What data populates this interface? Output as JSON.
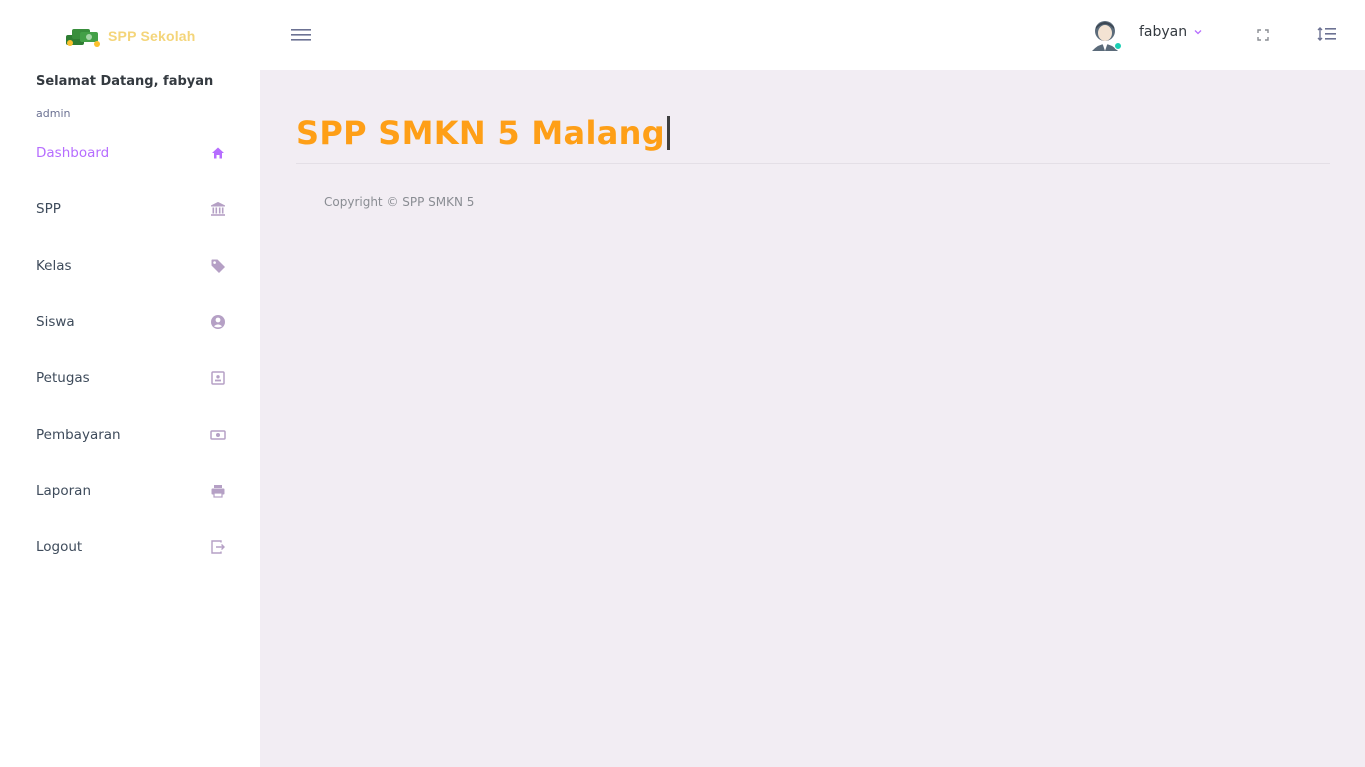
{
  "navbar": {
    "brand_text": "SPP Sekolah",
    "brand_icon": "money-stack-icon",
    "menu_icon": "hamburger-menu-icon",
    "profile_name": "fabyan",
    "status_color": "#1bcfb4",
    "fullscreen_icon": "fullscreen-icon",
    "settings_icon": "list-settings-icon"
  },
  "sidebar": {
    "welcome": "Selamat Datang, fabyan",
    "role": "admin",
    "accent_color": "#b66dff",
    "items": [
      {
        "label": "Dashboard",
        "icon": "home-icon",
        "active": true
      },
      {
        "label": "SPP",
        "icon": "bank-icon",
        "active": false
      },
      {
        "label": "Kelas",
        "icon": "tag-icon",
        "active": false
      },
      {
        "label": "Siswa",
        "icon": "user-circle-icon",
        "active": false
      },
      {
        "label": "Petugas",
        "icon": "contact-card-icon",
        "active": false
      },
      {
        "label": "Pembayaran",
        "icon": "cash-icon",
        "active": false
      },
      {
        "label": "Laporan",
        "icon": "printer-icon",
        "active": false
      },
      {
        "label": "Logout",
        "icon": "logout-icon",
        "active": false
      }
    ]
  },
  "main": {
    "title": "SPP SMKN 5 Malang",
    "title_color": "#fe9f17",
    "copyright": "Copyright © SPP SMKN 5"
  }
}
